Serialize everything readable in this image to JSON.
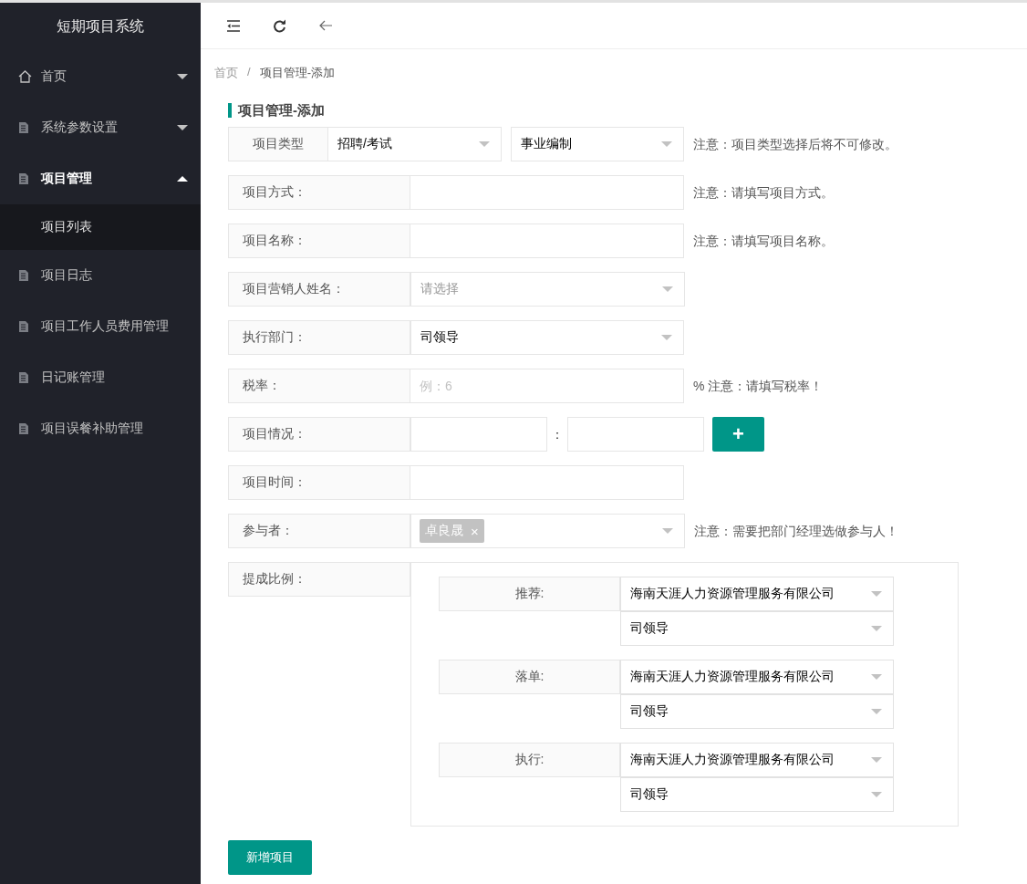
{
  "sidebar": {
    "title": "短期项目系统",
    "items": [
      {
        "label": "首页",
        "kind": "home",
        "expanded": false
      },
      {
        "label": "系统参数设置",
        "kind": "doc",
        "expanded": false
      },
      {
        "label": "项目管理",
        "kind": "doc",
        "expanded": true,
        "children": [
          {
            "label": "项目列表",
            "selected": true
          }
        ]
      },
      {
        "label": "项目日志",
        "kind": "doc"
      },
      {
        "label": "项目工作人员费用管理",
        "kind": "doc"
      },
      {
        "label": "日记账管理",
        "kind": "doc"
      },
      {
        "label": "项目误餐补助管理",
        "kind": "doc"
      }
    ]
  },
  "breadcrumb": {
    "items": [
      "首页",
      "项目管理-添加"
    ],
    "separator": "/"
  },
  "form": {
    "title": "项目管理-添加",
    "rows": [
      {
        "kind": "dual-select",
        "label": "项目类型",
        "selects": [
          "招聘/考试",
          "事业编制"
        ],
        "note": "注意：项目类型选择后将不可修改。"
      },
      {
        "kind": "input",
        "label": "项目方式：",
        "note": "注意：请填写项目方式。"
      },
      {
        "kind": "input",
        "label": "项目名称：",
        "note": "注意：请填写项目名称。"
      },
      {
        "kind": "select",
        "label": "项目营销人姓名：",
        "placeholder": "请选择"
      },
      {
        "kind": "select",
        "label": "执行部门：",
        "value": "司领导"
      },
      {
        "kind": "input",
        "label": "税率：",
        "placeholder": "例：6",
        "note": "% 注意：请填写税率！"
      },
      {
        "kind": "pair",
        "label": "项目情况：",
        "separator": "：",
        "button": "+"
      },
      {
        "kind": "input",
        "label": "项目时间："
      },
      {
        "kind": "tags",
        "label": "参与者：",
        "tags": [
          {
            "text": "卓良晟",
            "remove": "×"
          }
        ],
        "note": "注意：需要把部门经理选做参与人！"
      },
      {
        "kind": "commission",
        "label": "提成比例：",
        "groups": [
          {
            "label": "推荐:",
            "company": "海南天涯人力资源管理服务有限公司",
            "department": "司领导"
          },
          {
            "label": "落单:",
            "company": "海南天涯人力资源管理服务有限公司",
            "department": "司领导"
          },
          {
            "label": "执行:",
            "company": "海南天涯人力资源管理服务有限公司",
            "department": "司领导"
          }
        ]
      }
    ],
    "submit": "新增项目"
  }
}
